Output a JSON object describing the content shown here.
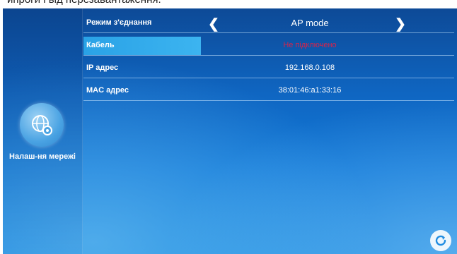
{
  "top_text": "ипроги і від перезавантаження.",
  "sidebar": {
    "network_settings_label": "Налаш-ня мережі"
  },
  "settings": {
    "connection_mode": {
      "label": "Режим з'єднання",
      "value": "AP mode"
    },
    "cable": {
      "label": "Кабель",
      "value": "Не підключено"
    },
    "ip": {
      "label": "IP адрес",
      "value": "192.168.0.108"
    },
    "mac": {
      "label": "MAC адрес",
      "value": "38:01:46:a1:33:16"
    }
  },
  "colors": {
    "accent": "#3cb4f0",
    "error": "#d8234a",
    "background": "#1279d8"
  },
  "icons": {
    "prev": "chevron-left-icon",
    "next": "chevron-right-icon",
    "network": "network-settings-icon",
    "refresh": "refresh-icon"
  }
}
